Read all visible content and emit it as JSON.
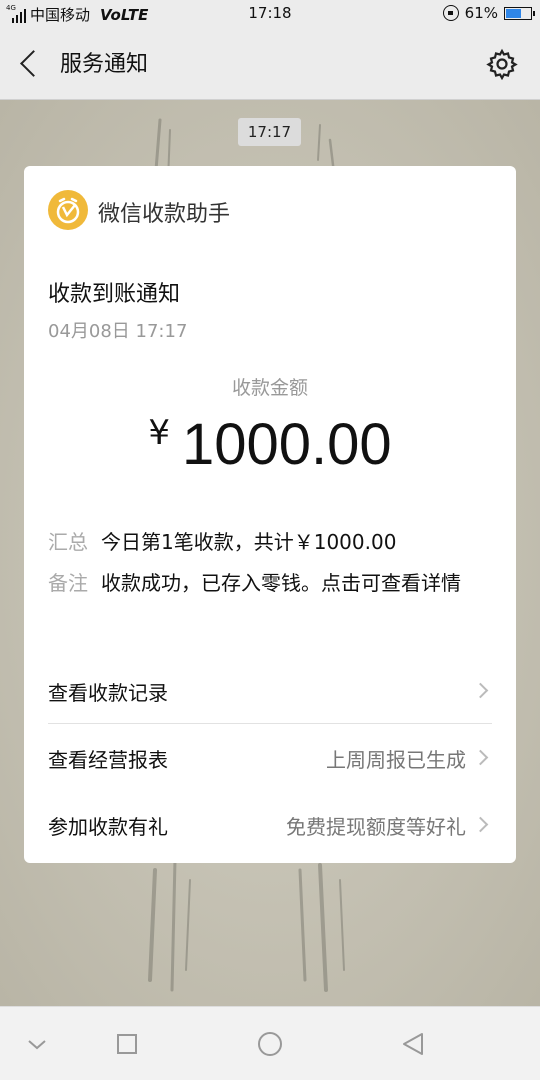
{
  "status_bar": {
    "network_tag": "4G",
    "carrier": "中国移动",
    "volte": "VoLTE",
    "time": "17:18",
    "battery": "61%",
    "battery_level": 0.61,
    "battery_color": "#2f86e8"
  },
  "header": {
    "back_icon": "back-arrow-icon",
    "title": "服务通知",
    "settings_icon": "gear-icon"
  },
  "chat": {
    "timestamp": "17:17",
    "background_color": "#c6c3b6"
  },
  "card": {
    "app_icon": "wechat-pay-clock-icon",
    "app_icon_color": "#f0b93a",
    "app_name": "微信收款助手",
    "notice_title": "收款到账通知",
    "notice_date": "04月08日 17:17",
    "amount_label": "收款金额",
    "currency_symbol": "¥",
    "amount": "1000.00",
    "rows": [
      {
        "key": "汇总",
        "value": "今日第1笔收款，共计￥1000.00"
      },
      {
        "key": "备注",
        "value": "收款成功，已存入零钱。点击可查看详情"
      }
    ],
    "actions": [
      {
        "label": "查看收款记录",
        "hint": ""
      },
      {
        "label": "查看经营报表",
        "hint": "上周周报已生成"
      },
      {
        "label": "参加收款有礼",
        "hint": "免费提现额度等好礼"
      }
    ]
  },
  "nav_bar": {
    "buttons": [
      "chevron-down-icon",
      "square-icon",
      "circle-icon",
      "triangle-back-icon"
    ]
  }
}
